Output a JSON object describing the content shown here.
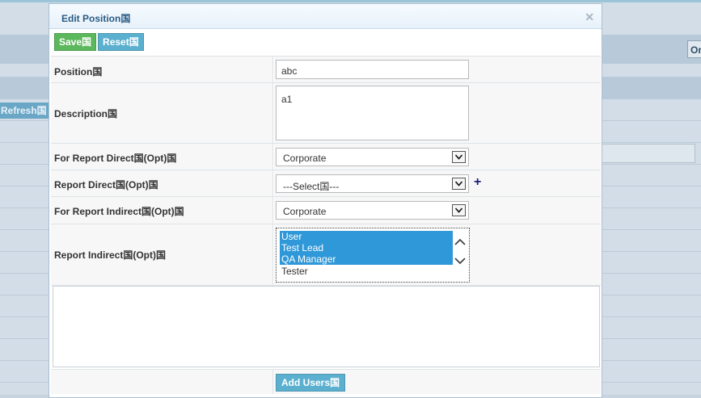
{
  "background": {
    "refresh_label": "Refresh国",
    "right_button_label": "Or"
  },
  "dialog": {
    "title": "Edit Position国",
    "close_icon": "close-icon",
    "toolbar": {
      "save_label": "Save国",
      "reset_label": "Reset国"
    },
    "fields": {
      "position": {
        "label": "Position国",
        "value": "abc"
      },
      "description": {
        "label": "Description国",
        "value": "a1"
      },
      "for_report_direct": {
        "label": "For Report Direct国(Opt)国",
        "selected": "Corporate"
      },
      "report_direct": {
        "label": "Report Direct国(Opt)国",
        "selected": "---Select国---"
      },
      "for_report_indirect": {
        "label": "For Report Indirect国(Opt)国",
        "selected": "Corporate"
      },
      "report_indirect": {
        "label": "Report Indirect国(Opt)国",
        "options": [
          {
            "text": "User",
            "selected": true
          },
          {
            "text": "Test Lead",
            "selected": true
          },
          {
            "text": "QA Manager",
            "selected": true
          },
          {
            "text": "Tester",
            "selected": false
          }
        ]
      }
    },
    "add_users_label": "Add Users国"
  },
  "colors": {
    "save": "#5cb85c",
    "accent": "#5bb0cf",
    "selection": "#2f98d8",
    "title_text": "#2b5c85"
  }
}
